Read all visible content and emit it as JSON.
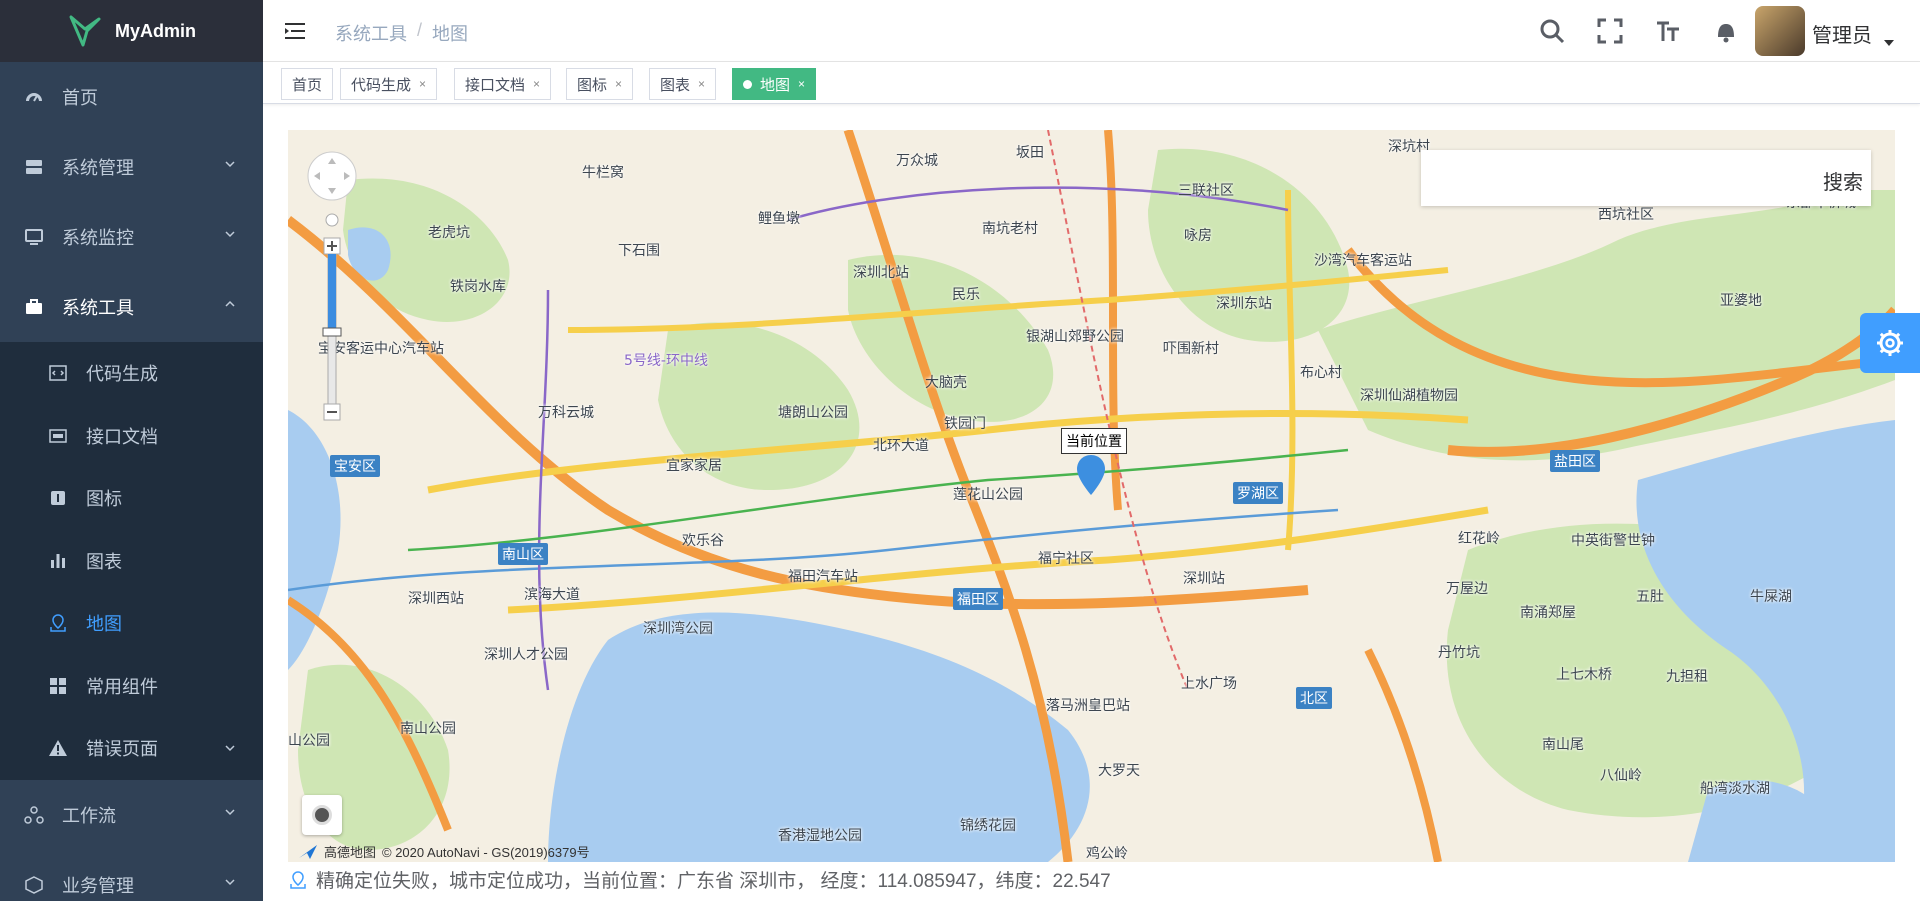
{
  "app": {
    "brand": "MyAdmin"
  },
  "sidebar": {
    "items": [
      {
        "label": "首页"
      },
      {
        "label": "系统管理"
      },
      {
        "label": "系统监控"
      },
      {
        "label": "系统工具"
      },
      {
        "label": "工作流"
      },
      {
        "label": "业务管理"
      }
    ],
    "tools_sub": [
      {
        "label": "代码生成"
      },
      {
        "label": "接口文档"
      },
      {
        "label": "图标"
      },
      {
        "label": "图表"
      },
      {
        "label": "地图"
      },
      {
        "label": "常用组件"
      },
      {
        "label": "错误页面"
      }
    ]
  },
  "header": {
    "breadcrumb": [
      "系统工具",
      "地图"
    ],
    "breadcrumb_sep": "/",
    "username": "管理员"
  },
  "tags": [
    {
      "label": "首页"
    },
    {
      "label": "代码生成",
      "close": "×"
    },
    {
      "label": "接口文档",
      "close": "×"
    },
    {
      "label": "图标",
      "close": "×"
    },
    {
      "label": "图表",
      "close": "×"
    },
    {
      "label": "地图",
      "close": "×"
    }
  ],
  "map": {
    "search_label": "搜索",
    "marker_label": "当前位置",
    "copyright": "© 2020 AutoNavi - GS(2019)6379号",
    "provider": "高德地图",
    "places": [
      "万众城",
      "牛栏窝",
      "鲤鱼墩",
      "深圳北站",
      "南坑老村",
      "民乐",
      "老虎坑",
      "下石围",
      "铁岗水库",
      "宝安客运中心汽车站",
      "万科云城",
      "塘朗山公园",
      "大脑壳",
      "银湖山郊野公园",
      "宜家家居",
      "北环大道",
      "铁园门",
      "莲花山公园",
      "欢乐谷",
      "福田汽车站",
      "深圳西站",
      "滨海大道",
      "深圳湾公园",
      "深圳人才公园",
      "南山公园",
      "落马洲皇巴站",
      "上水广场",
      "香港湿地公园",
      "锦绣花园",
      "大罗天",
      "鸡公岭",
      "深圳站",
      "深圳东站",
      "沙湾汽车客运站",
      "吓围新村",
      "深圳仙湖植物园",
      "布心村",
      "红花岭",
      "中英街警世钟",
      "万屋边",
      "南涌郑屋",
      "丹竹坑",
      "上七木桥",
      "九担租",
      "五肚",
      "牛屎湖",
      "南山尾",
      "八仙岭",
      "船湾淡水湖",
      "亚婆地",
      "三联社区",
      "西坑社区",
      "咏房",
      "福宁社区",
      "坂田",
      "深坑村",
      "山公园",
      "5号线-环中线",
      "东部华侨城"
    ],
    "districts": [
      "宝安区",
      "南山区",
      "福田区",
      "罗湖区",
      "盐田区",
      "北区"
    ]
  },
  "status": {
    "text": "精确定位失败，城市定位成功，当前位置：广东省 深圳市， 经度：114.085947，纬度：22.547"
  },
  "colors": {
    "sidebar_bg": "#304156",
    "active": "#409eff",
    "tag_active": "#42b983"
  }
}
